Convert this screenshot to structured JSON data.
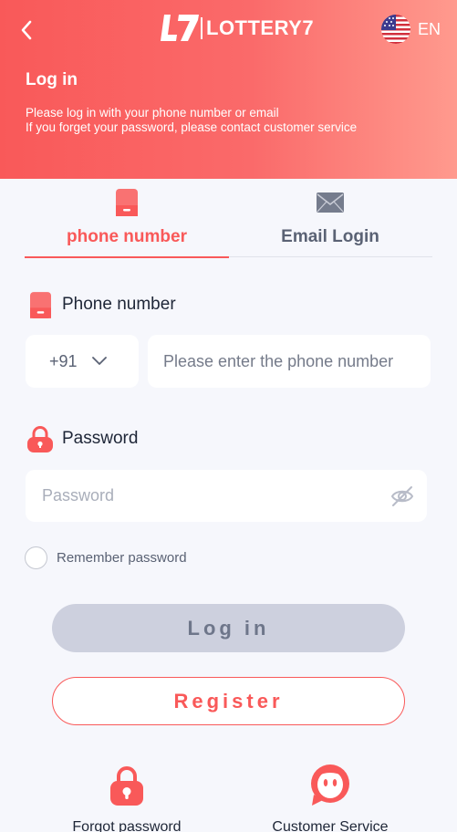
{
  "header": {
    "brand": "LOTTERY7",
    "language": "EN",
    "title": "Log in",
    "subtitle_line1": "Please log in with your phone number or email",
    "subtitle_line2": "If you forget your password, please contact customer service"
  },
  "tabs": {
    "phone_label": "phone number",
    "email_label": "Email Login"
  },
  "phone_field": {
    "label": "Phone number",
    "country_code": "+91",
    "placeholder": "Please enter the phone number"
  },
  "password_field": {
    "label": "Password",
    "placeholder": "Password"
  },
  "remember_label": "Remember password",
  "buttons": {
    "login": "Log in",
    "register": "Register"
  },
  "footer": {
    "forgot_label": "Forgot password",
    "service_label": "Customer Service"
  },
  "colors": {
    "accent": "#f95959",
    "header_gradient_end": "#ff9a8e",
    "background": "#f6f7fc",
    "login_button": "#cdd0de"
  },
  "icons": [
    "back-arrow-icon",
    "logo-icon",
    "us-flag-icon",
    "phone-icon",
    "email-icon",
    "lock-icon",
    "chevron-down-icon",
    "eye-off-icon",
    "customer-service-icon"
  ]
}
